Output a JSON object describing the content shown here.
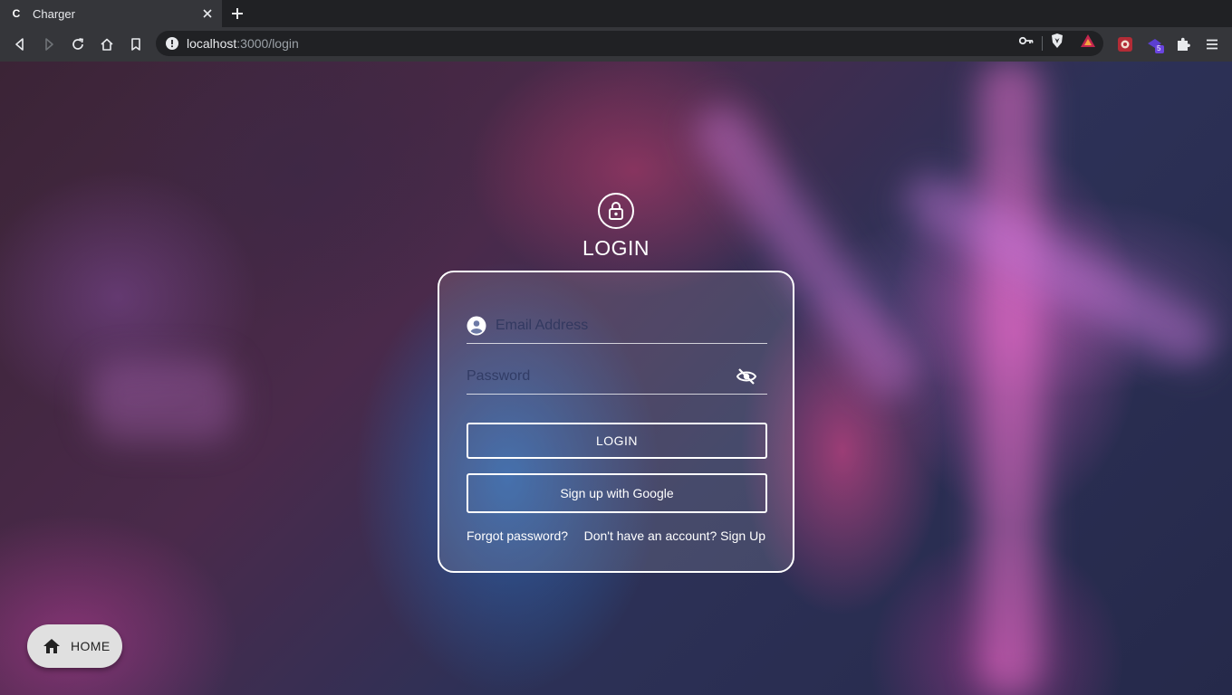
{
  "browser": {
    "tab": {
      "favicon_letter": "C",
      "title": "Charger"
    },
    "address": {
      "host": "localhost",
      "path": ":3000/login"
    },
    "extension_badge": "5"
  },
  "login": {
    "title": "LOGIN",
    "email_placeholder": "Email Address",
    "password_placeholder": "Password",
    "login_button": "LOGIN",
    "google_button": "Sign up with Google",
    "forgot_link": "Forgot password?",
    "signup_link": "Don't have an account? Sign Up"
  },
  "home_button": {
    "label": "HOME"
  },
  "colors": {
    "chrome_dark": "#202124",
    "chrome_toolbar": "#35363a",
    "card_border": "#ffffff",
    "fab_background": "#e0e0e0"
  }
}
